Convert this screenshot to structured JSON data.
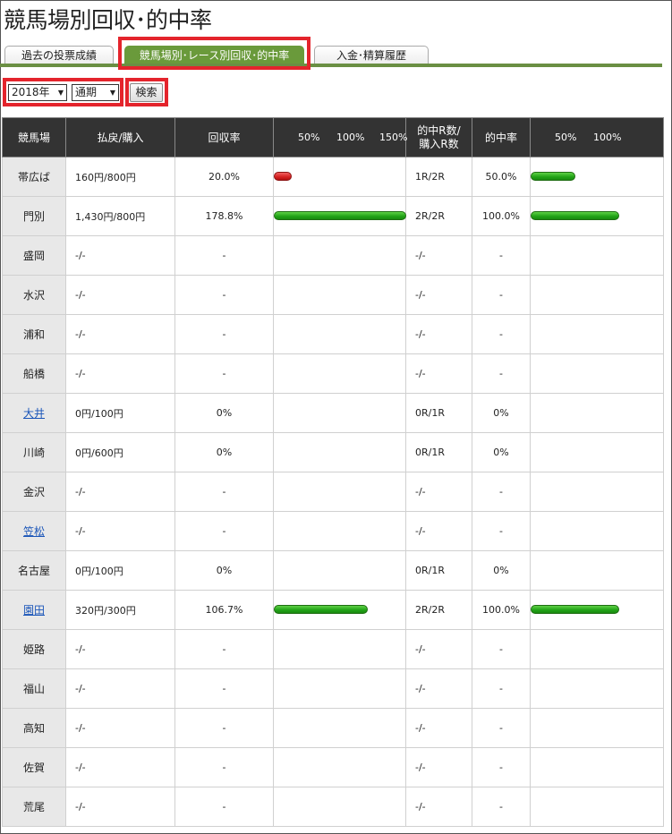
{
  "page_title": "競馬場別回収･的中率",
  "tabs": [
    {
      "label": "過去の投票成績"
    },
    {
      "label": "競馬場別･レース別回収･的中率"
    },
    {
      "label": "入金･精算履歴"
    }
  ],
  "filters": {
    "year": "2018年",
    "period": "通期",
    "search_label": "検索"
  },
  "table": {
    "headers": {
      "venue": "競馬場",
      "payout": "払戻/購入",
      "recovery": "回収率",
      "recovery_ticks": [
        "50%",
        "100%",
        "150%"
      ],
      "hits_line1": "的中R数/",
      "hits_line2": "購入R数",
      "hit_rate": "的中率",
      "hit_ticks": [
        "50%",
        "100%"
      ]
    },
    "rows": [
      {
        "venue": "帯広ば",
        "link": false,
        "payout": "160円/800円",
        "recovery": "20.0%",
        "recovery_value": 20.0,
        "hits": "1R/2R",
        "hit_rate": "50.0%",
        "hit_value": 50.0
      },
      {
        "venue": "門別",
        "link": false,
        "payout": "1,430円/800円",
        "recovery": "178.8%",
        "recovery_value": 178.8,
        "hits": "2R/2R",
        "hit_rate": "100.0%",
        "hit_value": 100.0
      },
      {
        "venue": "盛岡",
        "link": false,
        "payout": "-/-",
        "recovery": "-",
        "hits": "-/-",
        "hit_rate": "-"
      },
      {
        "venue": "水沢",
        "link": false,
        "payout": "-/-",
        "recovery": "-",
        "hits": "-/-",
        "hit_rate": "-"
      },
      {
        "venue": "浦和",
        "link": false,
        "payout": "-/-",
        "recovery": "-",
        "hits": "-/-",
        "hit_rate": "-"
      },
      {
        "venue": "船橋",
        "link": false,
        "payout": "-/-",
        "recovery": "-",
        "hits": "-/-",
        "hit_rate": "-"
      },
      {
        "venue": "大井",
        "link": true,
        "payout": "0円/100円",
        "recovery": "0%",
        "recovery_value": 0,
        "hits": "0R/1R",
        "hit_rate": "0%",
        "hit_value": 0
      },
      {
        "venue": "川崎",
        "link": false,
        "payout": "0円/600円",
        "recovery": "0%",
        "recovery_value": 0,
        "hits": "0R/1R",
        "hit_rate": "0%",
        "hit_value": 0
      },
      {
        "venue": "金沢",
        "link": false,
        "payout": "-/-",
        "recovery": "-",
        "hits": "-/-",
        "hit_rate": "-"
      },
      {
        "venue": "笠松",
        "link": true,
        "payout": "-/-",
        "recovery": "-",
        "hits": "-/-",
        "hit_rate": "-"
      },
      {
        "venue": "名古屋",
        "link": false,
        "payout": "0円/100円",
        "recovery": "0%",
        "recovery_value": 0,
        "hits": "0R/1R",
        "hit_rate": "0%",
        "hit_value": 0
      },
      {
        "venue": "園田",
        "link": true,
        "payout": "320円/300円",
        "recovery": "106.7%",
        "recovery_value": 106.7,
        "hits": "2R/2R",
        "hit_rate": "100.0%",
        "hit_value": 100.0
      },
      {
        "venue": "姫路",
        "link": false,
        "payout": "-/-",
        "recovery": "-",
        "hits": "-/-",
        "hit_rate": "-"
      },
      {
        "venue": "福山",
        "link": false,
        "payout": "-/-",
        "recovery": "-",
        "hits": "-/-",
        "hit_rate": "-"
      },
      {
        "venue": "高知",
        "link": false,
        "payout": "-/-",
        "recovery": "-",
        "hits": "-/-",
        "hit_rate": "-"
      },
      {
        "venue": "佐賀",
        "link": false,
        "payout": "-/-",
        "recovery": "-",
        "hits": "-/-",
        "hit_rate": "-"
      },
      {
        "venue": "荒尾",
        "link": false,
        "payout": "-/-",
        "recovery": "-",
        "hits": "-/-",
        "hit_rate": "-"
      }
    ]
  },
  "colors": {
    "accent_green": "#6a9a3b",
    "bar_green": "#20a216",
    "bar_red": "#d52020",
    "highlight_red": "#e4242c",
    "header_bg": "#333333"
  }
}
